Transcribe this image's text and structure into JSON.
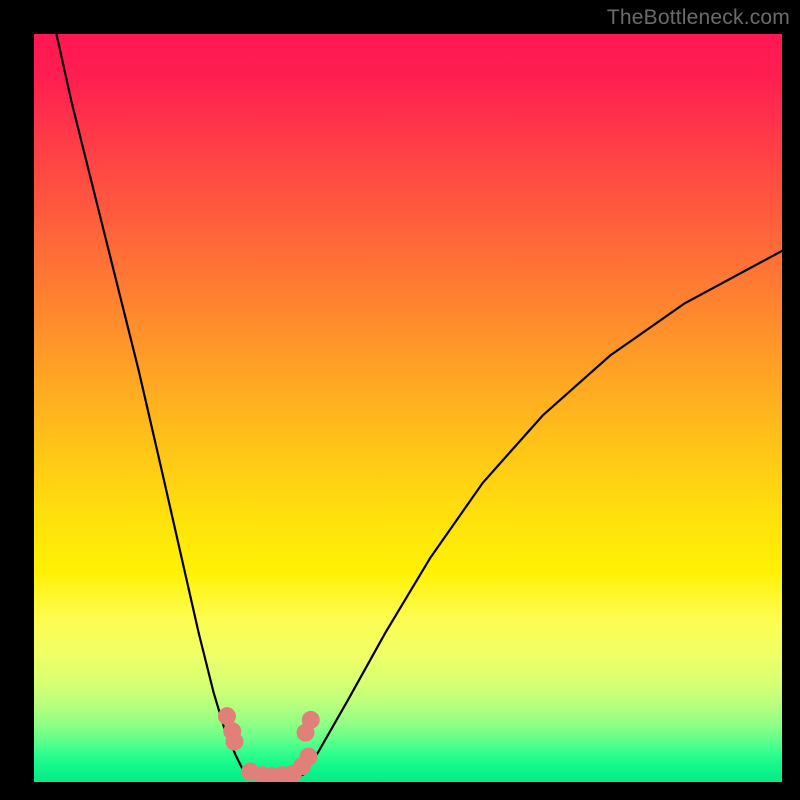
{
  "watermark": {
    "text": "TheBottleneck.com"
  },
  "colors": {
    "frame": "#000000",
    "curve": "#000000",
    "marker_fill": "#e18079",
    "marker_stroke": "#a65650"
  },
  "chart_data": {
    "type": "line",
    "title": "",
    "xlabel": "",
    "ylabel": "",
    "xlim": [
      0,
      100
    ],
    "ylim": [
      0,
      100
    ],
    "grid": false,
    "legend": false,
    "series": [
      {
        "name": "left-branch",
        "x": [
          3,
          5,
          8,
          11,
          14,
          17,
          19.5,
          22,
          24,
          25.5,
          27,
          28,
          28.8
        ],
        "y": [
          100,
          91,
          79,
          67,
          55,
          42,
          31,
          20,
          12,
          7,
          3.5,
          1.5,
          0.5
        ]
      },
      {
        "name": "valley",
        "x": [
          28.8,
          30,
          31.5,
          33,
          34.5,
          36
        ],
        "y": [
          0.5,
          0.5,
          0.4,
          0.4,
          0.5,
          1
        ]
      },
      {
        "name": "right-branch",
        "x": [
          36,
          38,
          42,
          47,
          53,
          60,
          68,
          77,
          87,
          100
        ],
        "y": [
          1,
          4,
          11,
          20,
          30,
          40,
          49,
          57,
          64,
          71
        ]
      }
    ],
    "markers": [
      {
        "x": 25.8,
        "y": 8.8
      },
      {
        "x": 26.5,
        "y": 6.8
      },
      {
        "x": 26.8,
        "y": 5.4
      },
      {
        "x": 28.9,
        "y": 1.4
      },
      {
        "x": 30.5,
        "y": 0.9
      },
      {
        "x": 31.8,
        "y": 0.8
      },
      {
        "x": 33.2,
        "y": 0.9
      },
      {
        "x": 34.6,
        "y": 1.1
      },
      {
        "x": 35.8,
        "y": 2.1
      },
      {
        "x": 36.7,
        "y": 3.4
      },
      {
        "x": 36.3,
        "y": 6.6
      },
      {
        "x": 37.0,
        "y": 8.3
      }
    ]
  }
}
